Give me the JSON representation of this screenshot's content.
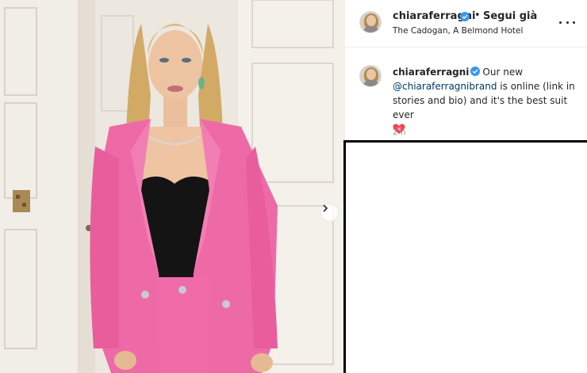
{
  "post": {
    "username": "chiaraferragni",
    "verified": true,
    "separator": "•",
    "follow_status": "Segui già",
    "location": "The Cadogan, A Belmond Hotel",
    "more_icon": "more-horizontal-icon"
  },
  "caption": {
    "username": "chiaraferragni",
    "text_before": "Our new ",
    "mention": "@chiaraferragnibrand",
    "text_after": " is online (link in stories and bio) and it's the best suit ever",
    "emoji_icon": "sparkling-heart-icon",
    "timestamp": "2 h"
  },
  "media": {
    "next_icon": "chevron-right-icon",
    "colors": {
      "suit_pink": "#ee6aa7",
      "door_white": "#f3efe9",
      "top_black": "#141414",
      "hair_blonde": "#d6b06e"
    }
  },
  "colors": {
    "verified_blue": "#3897f0",
    "mention_blue": "#00376b",
    "heart_red": "#ed4956",
    "text_muted": "#8e8e8e"
  }
}
